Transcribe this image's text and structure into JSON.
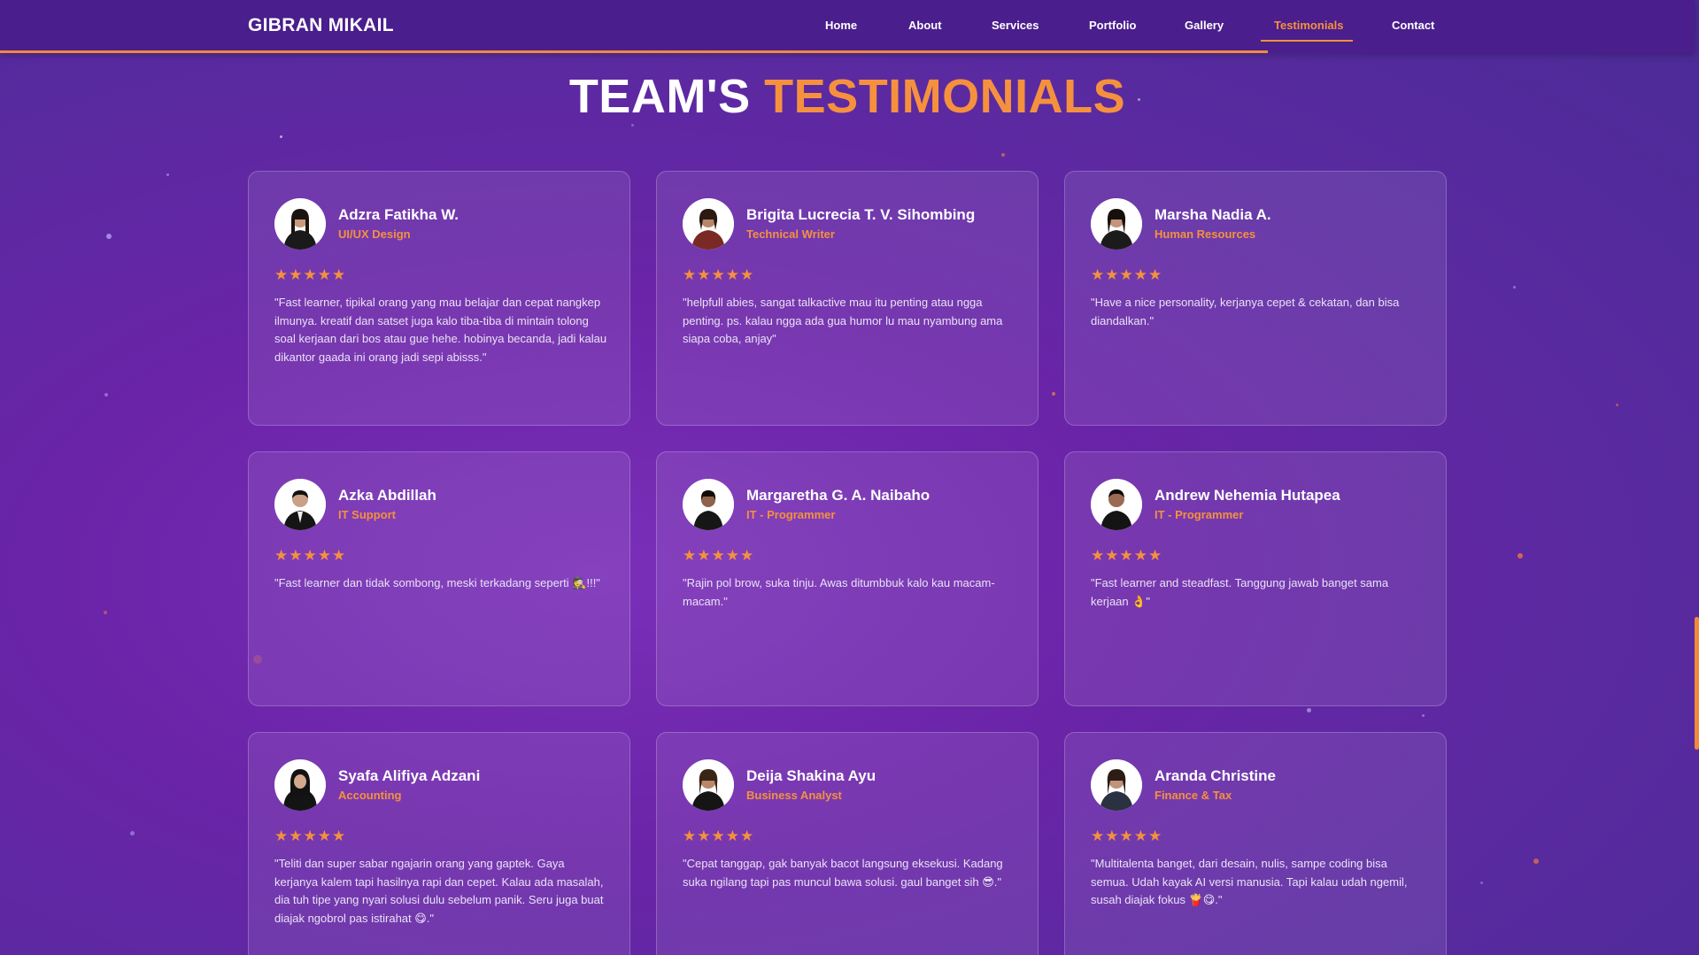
{
  "navbar": {
    "brand": "GIBRAN MIKAIL",
    "links": [
      "Home",
      "About",
      "Services",
      "Portfolio",
      "Gallery",
      "Testimonials",
      "Contact"
    ],
    "active": "Testimonials"
  },
  "section": {
    "title_part1": "TEAM'S",
    "title_part2": "TESTIMONIALS"
  },
  "colors": {
    "accent": "#f5913e",
    "navbar": "#4a1e8c",
    "background": "#6a24a8"
  },
  "rating_stars": "★★★★★",
  "testimonials": [
    {
      "name": "Adzra Fatikha W.",
      "role": "UI/UX Design",
      "rating": 5,
      "quote": "\"Fast learner, tipikal orang yang mau belajar dan cepat nangkep ilmunya. kreatif dan satset juga kalo tiba-tiba di mintain tolong soal kerjaan dari bos atau gue hehe. hobinya becanda, jadi kalau dikantor gaada ini orang jadi sepi abisss.\""
    },
    {
      "name": "Brigita Lucrecia T. V. Sihombing",
      "role": "Technical Writer",
      "rating": 5,
      "quote": "\"helpfull abies, sangat talkactive mau itu penting atau ngga penting. ps. kalau ngga ada gua humor lu mau nyambung ama siapa coba, anjay\""
    },
    {
      "name": "Marsha Nadia A.",
      "role": "Human Resources",
      "rating": 5,
      "quote": "\"Have a nice personality, kerjanya cepet & cekatan, dan bisa diandalkan.\""
    },
    {
      "name": "Azka Abdillah",
      "role": "IT Support",
      "rating": 5,
      "quote": "\"Fast learner dan tidak sombong, meski terkadang seperti 🕵️!!!\""
    },
    {
      "name": "Margaretha G. A. Naibaho",
      "role": "IT - Programmer",
      "rating": 5,
      "quote": "\"Rajin pol brow, suka tinju. Awas ditumbbuk kalo kau macam-macam.\""
    },
    {
      "name": "Andrew Nehemia Hutapea",
      "role": "IT - Programmer",
      "rating": 5,
      "quote": "\"Fast learner and steadfast. Tanggung jawab banget sama kerjaan 👌\""
    },
    {
      "name": "Syafa Alifiya Adzani",
      "role": "Accounting",
      "rating": 5,
      "quote": "\"Teliti dan super sabar ngajarin orang yang gaptek. Gaya kerjanya kalem tapi hasilnya rapi dan cepet. Kalau ada masalah, dia tuh tipe yang nyari solusi dulu sebelum panik. Seru juga buat diajak ngobrol pas istirahat 😋.\""
    },
    {
      "name": "Deija Shakina Ayu",
      "role": "Business Analyst",
      "rating": 5,
      "quote": "\"Cepat tanggap, gak banyak bacot langsung eksekusi. Kadang suka ngilang tapi pas muncul bawa solusi. gaul banget sih 😎.\""
    },
    {
      "name": "Aranda Christine",
      "role": "Finance & Tax",
      "rating": 5,
      "quote": "\"Multitalenta banget, dari desain, nulis, sampe coding bisa semua. Udah kayak AI versi manusia. Tapi kalau udah ngemil, susah diajak fokus 🍟😋.\""
    }
  ]
}
